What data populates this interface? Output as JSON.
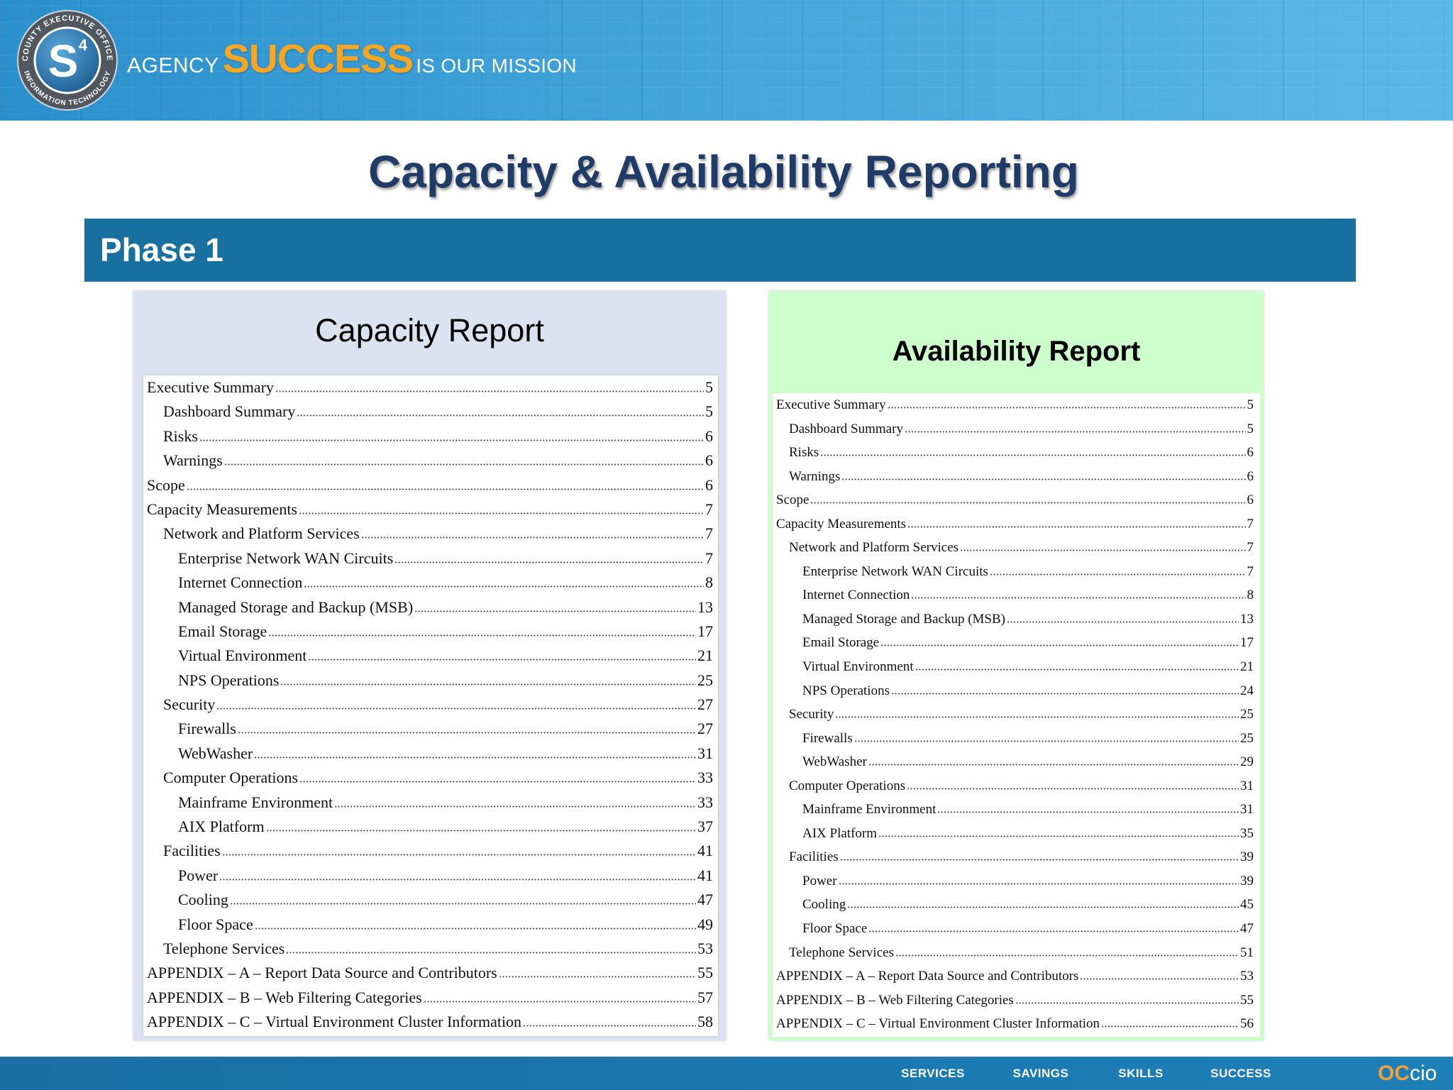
{
  "banner": {
    "tagline_prefix": "AGENCY",
    "tagline_emphasis": "SUCCESS",
    "tagline_suffix": "IS OUR MISSION",
    "logo": {
      "top_arc": "COUNTY EXECUTIVE OFFICE",
      "bottom_arc": "INFORMATION TECHNOLOGY",
      "letter": "S",
      "superscript": "4"
    }
  },
  "slide": {
    "title": "Capacity & Availability Reporting",
    "section_label": "Phase 1"
  },
  "capacity_report": {
    "title": "Capacity Report",
    "toc": [
      {
        "level": 0,
        "label": "Executive Summary",
        "page": "5"
      },
      {
        "level": 1,
        "label": "Dashboard Summary",
        "page": "5"
      },
      {
        "level": 1,
        "label": "Risks",
        "page": "6"
      },
      {
        "level": 1,
        "label": "Warnings",
        "page": "6"
      },
      {
        "level": 0,
        "label": "Scope",
        "page": "6"
      },
      {
        "level": 0,
        "label": "Capacity Measurements",
        "page": "7"
      },
      {
        "level": 1,
        "label": "Network and Platform Services",
        "page": "7"
      },
      {
        "level": 2,
        "label": "Enterprise Network WAN Circuits",
        "page": "7"
      },
      {
        "level": 2,
        "label": "Internet Connection",
        "page": "8"
      },
      {
        "level": 2,
        "label": "Managed Storage and Backup (MSB)",
        "page": "13"
      },
      {
        "level": 2,
        "label": "Email Storage",
        "page": "17"
      },
      {
        "level": 2,
        "label": "Virtual Environment",
        "page": "21"
      },
      {
        "level": 2,
        "label": "NPS Operations",
        "page": "25"
      },
      {
        "level": 1,
        "label": "Security",
        "page": "27"
      },
      {
        "level": 2,
        "label": "Firewalls",
        "page": "27"
      },
      {
        "level": 2,
        "label": "WebWasher",
        "page": "31"
      },
      {
        "level": 1,
        "label": "Computer Operations",
        "page": "33"
      },
      {
        "level": 2,
        "label": "Mainframe Environment",
        "page": "33"
      },
      {
        "level": 2,
        "label": "AIX Platform",
        "page": "37"
      },
      {
        "level": 1,
        "label": "Facilities",
        "page": "41"
      },
      {
        "level": 2,
        "label": "Power",
        "page": "41"
      },
      {
        "level": 2,
        "label": "Cooling",
        "page": "47"
      },
      {
        "level": 2,
        "label": "Floor Space",
        "page": "49"
      },
      {
        "level": 1,
        "label": "Telephone Services",
        "page": "53"
      },
      {
        "level": 0,
        "label": "APPENDIX – A – Report Data Source and Contributors",
        "page": "55"
      },
      {
        "level": 0,
        "label": "APPENDIX – B – Web Filtering Categories",
        "page": "57"
      },
      {
        "level": 0,
        "label": "APPENDIX – C – Virtual Environment Cluster Information",
        "page": "58"
      }
    ]
  },
  "availability_report": {
    "title": "Availability Report",
    "toc": [
      {
        "level": 0,
        "label": "Executive Summary",
        "page": "5"
      },
      {
        "level": 1,
        "label": "Dashboard Summary",
        "page": "5"
      },
      {
        "level": 1,
        "label": "Risks",
        "page": "6"
      },
      {
        "level": 1,
        "label": "Warnings",
        "page": "6"
      },
      {
        "level": 0,
        "label": "Scope",
        "page": "6"
      },
      {
        "level": 0,
        "label": "Capacity Measurements",
        "page": "7"
      },
      {
        "level": 1,
        "label": "Network and Platform Services",
        "page": "7"
      },
      {
        "level": 2,
        "label": "Enterprise Network WAN Circuits",
        "page": "7"
      },
      {
        "level": 2,
        "label": "Internet Connection",
        "page": "8"
      },
      {
        "level": 2,
        "label": "Managed Storage and Backup (MSB)",
        "page": "13"
      },
      {
        "level": 2,
        "label": "Email Storage",
        "page": "17"
      },
      {
        "level": 2,
        "label": "Virtual Environment",
        "page": "21"
      },
      {
        "level": 2,
        "label": "NPS Operations",
        "page": "24"
      },
      {
        "level": 1,
        "label": "Security",
        "page": "25"
      },
      {
        "level": 2,
        "label": "Firewalls",
        "page": "25"
      },
      {
        "level": 2,
        "label": "WebWasher",
        "page": "29"
      },
      {
        "level": 1,
        "label": "Computer Operations",
        "page": "31"
      },
      {
        "level": 2,
        "label": "Mainframe Environment",
        "page": "31"
      },
      {
        "level": 2,
        "label": "AIX Platform",
        "page": "35"
      },
      {
        "level": 1,
        "label": "Facilities",
        "page": "39"
      },
      {
        "level": 2,
        "label": "Power",
        "page": "39"
      },
      {
        "level": 2,
        "label": "Cooling",
        "page": "45"
      },
      {
        "level": 2,
        "label": "Floor Space",
        "page": "47"
      },
      {
        "level": 1,
        "label": "Telephone Services",
        "page": "51"
      },
      {
        "level": 0,
        "label": "APPENDIX – A – Report Data Source and Contributors",
        "page": "53"
      },
      {
        "level": 0,
        "label": "APPENDIX – B – Web Filtering Categories",
        "page": "55"
      },
      {
        "level": 0,
        "label": "APPENDIX – C – Virtual Environment Cluster Information",
        "page": "56"
      }
    ]
  },
  "footer": {
    "nav": [
      "SERVICES",
      "SAVINGS",
      "SKILLS",
      "SUCCESS"
    ],
    "logo": {
      "prefix": "OC",
      "suffix": "cio"
    }
  },
  "colors": {
    "banner_start": "#2b8fcb",
    "banner_end": "#5ab8e6",
    "title": "#1f3b66",
    "phase_bar": "#17709f",
    "capacity_panel": "#dbe3f0",
    "availability_panel": "#ccffcc",
    "success_orange": "#f6a623",
    "footer": "#1b78b0",
    "footer_logo_accent": "#f2a13a"
  }
}
